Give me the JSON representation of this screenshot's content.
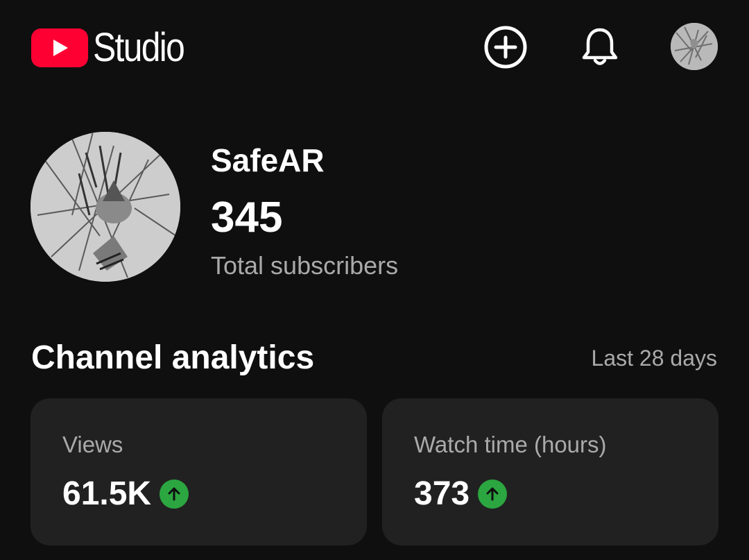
{
  "header": {
    "logo_text": "Studio",
    "icons": {
      "create": "create-plus-icon",
      "notifications": "bell-icon",
      "account": "account-avatar"
    }
  },
  "channel": {
    "name": "SafeAR",
    "subscriber_count": "345",
    "subscriber_label": "Total subscribers"
  },
  "analytics": {
    "title": "Channel analytics",
    "period": "Last 28 days",
    "cards": [
      {
        "label": "Views",
        "value": "61.5K",
        "trend": "up"
      },
      {
        "label": "Watch time (hours)",
        "value": "373",
        "trend": "up"
      }
    ]
  },
  "colors": {
    "background": "#0f0f0f",
    "card": "#212121",
    "brand_red": "#ff0033",
    "trend_up": "#2ba640",
    "secondary_text": "#aaaaaa"
  }
}
